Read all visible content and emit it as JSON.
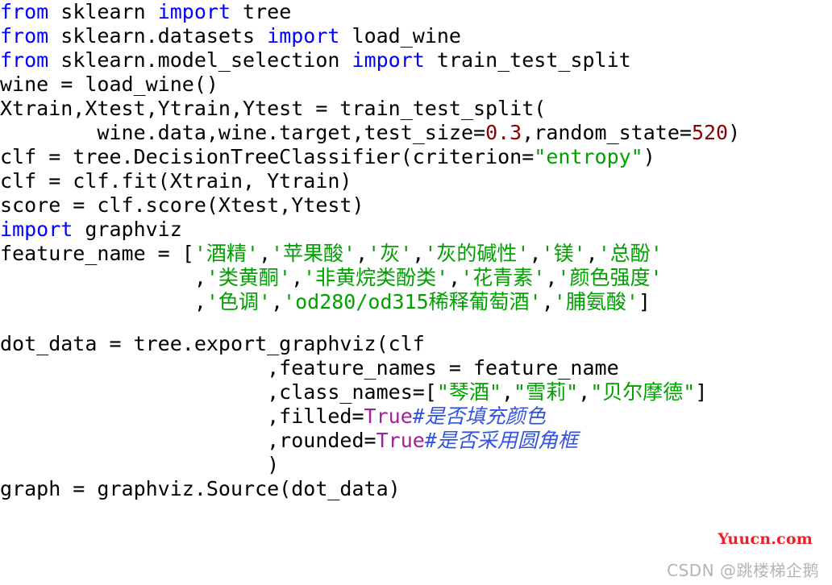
{
  "document": {
    "kind": "python-code-screenshot",
    "language": "Python",
    "background_color": "#ffffff"
  },
  "syntax_colors": {
    "keyword": "#0000ff",
    "string": "#00a000",
    "number": "#8b0000",
    "boolean": "#a020a0",
    "comment": "#3355dd",
    "plain": "#000000"
  },
  "code": {
    "lines": [
      {
        "id": "line-1",
        "tokens": [
          {
            "t": "from",
            "c": "kw"
          },
          {
            "t": " sklearn ",
            "c": "plain"
          },
          {
            "t": "import",
            "c": "kw"
          },
          {
            "t": " tree",
            "c": "plain"
          }
        ]
      },
      {
        "id": "line-2",
        "tokens": [
          {
            "t": "from",
            "c": "kw"
          },
          {
            "t": " sklearn.datasets ",
            "c": "plain"
          },
          {
            "t": "import",
            "c": "kw"
          },
          {
            "t": " load_wine",
            "c": "plain"
          }
        ]
      },
      {
        "id": "line-3",
        "tokens": [
          {
            "t": "from",
            "c": "kw"
          },
          {
            "t": " sklearn.model_selection ",
            "c": "plain"
          },
          {
            "t": "import",
            "c": "kw"
          },
          {
            "t": " train_test_split",
            "c": "plain"
          }
        ]
      },
      {
        "id": "line-4",
        "tokens": [
          {
            "t": "wine = load_wine()",
            "c": "plain"
          }
        ]
      },
      {
        "id": "line-5",
        "tokens": [
          {
            "t": "Xtrain,Xtest,Ytrain,Ytest = train_test_split(",
            "c": "plain"
          }
        ]
      },
      {
        "id": "line-6",
        "tokens": [
          {
            "t": "        wine.data,wine.target,test_size=",
            "c": "plain"
          },
          {
            "t": "0.3",
            "c": "num"
          },
          {
            "t": ",random_state=",
            "c": "plain"
          },
          {
            "t": "520",
            "c": "num"
          },
          {
            "t": ")",
            "c": "plain"
          }
        ]
      },
      {
        "id": "line-7",
        "tokens": [
          {
            "t": "clf = tree.DecisionTreeClassifier(criterion=",
            "c": "plain"
          },
          {
            "t": "\"entropy\"",
            "c": "str"
          },
          {
            "t": ")",
            "c": "plain"
          }
        ]
      },
      {
        "id": "line-8",
        "tokens": [
          {
            "t": "clf = clf.fit(Xtrain, Ytrain)",
            "c": "plain"
          }
        ]
      },
      {
        "id": "line-9",
        "tokens": [
          {
            "t": "score = clf.score(Xtest,Ytest)",
            "c": "plain"
          }
        ]
      },
      {
        "id": "line-10",
        "tokens": [
          {
            "t": "import",
            "c": "kw"
          },
          {
            "t": " graphviz",
            "c": "plain"
          }
        ]
      },
      {
        "id": "line-11",
        "tokens": [
          {
            "t": "feature_name = [",
            "c": "plain"
          },
          {
            "t": "'酒精'",
            "c": "str"
          },
          {
            "t": ",",
            "c": "plain"
          },
          {
            "t": "'苹果酸'",
            "c": "str"
          },
          {
            "t": ",",
            "c": "plain"
          },
          {
            "t": "'灰'",
            "c": "str"
          },
          {
            "t": ",",
            "c": "plain"
          },
          {
            "t": "'灰的碱性'",
            "c": "str"
          },
          {
            "t": ",",
            "c": "plain"
          },
          {
            "t": "'镁'",
            "c": "str"
          },
          {
            "t": ",",
            "c": "plain"
          },
          {
            "t": "'总酚'",
            "c": "str"
          }
        ]
      },
      {
        "id": "line-12",
        "tokens": [
          {
            "t": "                ,",
            "c": "plain"
          },
          {
            "t": "'类黄酮'",
            "c": "str"
          },
          {
            "t": ",",
            "c": "plain"
          },
          {
            "t": "'非黄烷类酚类'",
            "c": "str"
          },
          {
            "t": ",",
            "c": "plain"
          },
          {
            "t": "'花青素'",
            "c": "str"
          },
          {
            "t": ",",
            "c": "plain"
          },
          {
            "t": "'颜色强度'",
            "c": "str"
          }
        ]
      },
      {
        "id": "line-13",
        "tokens": [
          {
            "t": "                ,",
            "c": "plain"
          },
          {
            "t": "'色调'",
            "c": "str"
          },
          {
            "t": ",",
            "c": "plain"
          },
          {
            "t": "'od280/od315稀释葡萄酒'",
            "c": "str"
          },
          {
            "t": ",",
            "c": "plain"
          },
          {
            "t": "'脯氨酸'",
            "c": "str"
          },
          {
            "t": "]",
            "c": "plain"
          }
        ]
      },
      {
        "id": "line-blank-1",
        "blank": true,
        "tokens": []
      },
      {
        "id": "line-14",
        "tokens": [
          {
            "t": "dot_data = tree.export_graphviz(clf",
            "c": "plain"
          }
        ]
      },
      {
        "id": "line-15",
        "tokens": [
          {
            "t": "                      ,feature_names = feature_name",
            "c": "plain"
          }
        ]
      },
      {
        "id": "line-16",
        "tokens": [
          {
            "t": "                      ,class_names=[",
            "c": "plain"
          },
          {
            "t": "\"琴酒\"",
            "c": "str"
          },
          {
            "t": ",",
            "c": "plain"
          },
          {
            "t": "\"雪莉\"",
            "c": "str"
          },
          {
            "t": ",",
            "c": "plain"
          },
          {
            "t": "\"贝尔摩德\"",
            "c": "str"
          },
          {
            "t": "]",
            "c": "plain"
          }
        ]
      },
      {
        "id": "line-17",
        "tokens": [
          {
            "t": "                      ,filled=",
            "c": "plain"
          },
          {
            "t": "True",
            "c": "bool"
          },
          {
            "t": "#是否填充颜色",
            "c": "comment"
          }
        ]
      },
      {
        "id": "line-18",
        "tokens": [
          {
            "t": "                      ,rounded=",
            "c": "plain"
          },
          {
            "t": "True",
            "c": "bool"
          },
          {
            "t": "#是否采用圆角框",
            "c": "comment"
          }
        ]
      },
      {
        "id": "line-19",
        "tokens": [
          {
            "t": "                      )",
            "c": "plain"
          }
        ]
      },
      {
        "id": "line-20",
        "tokens": [
          {
            "t": "graph = graphviz.Source(dot_data)",
            "c": "plain"
          }
        ]
      }
    ]
  },
  "watermarks": {
    "site": "Yuucn.com",
    "site_color": "#e8212b",
    "csdn": "CSDN @跳楼梯企鹅",
    "csdn_color": "#b4b4b4"
  }
}
